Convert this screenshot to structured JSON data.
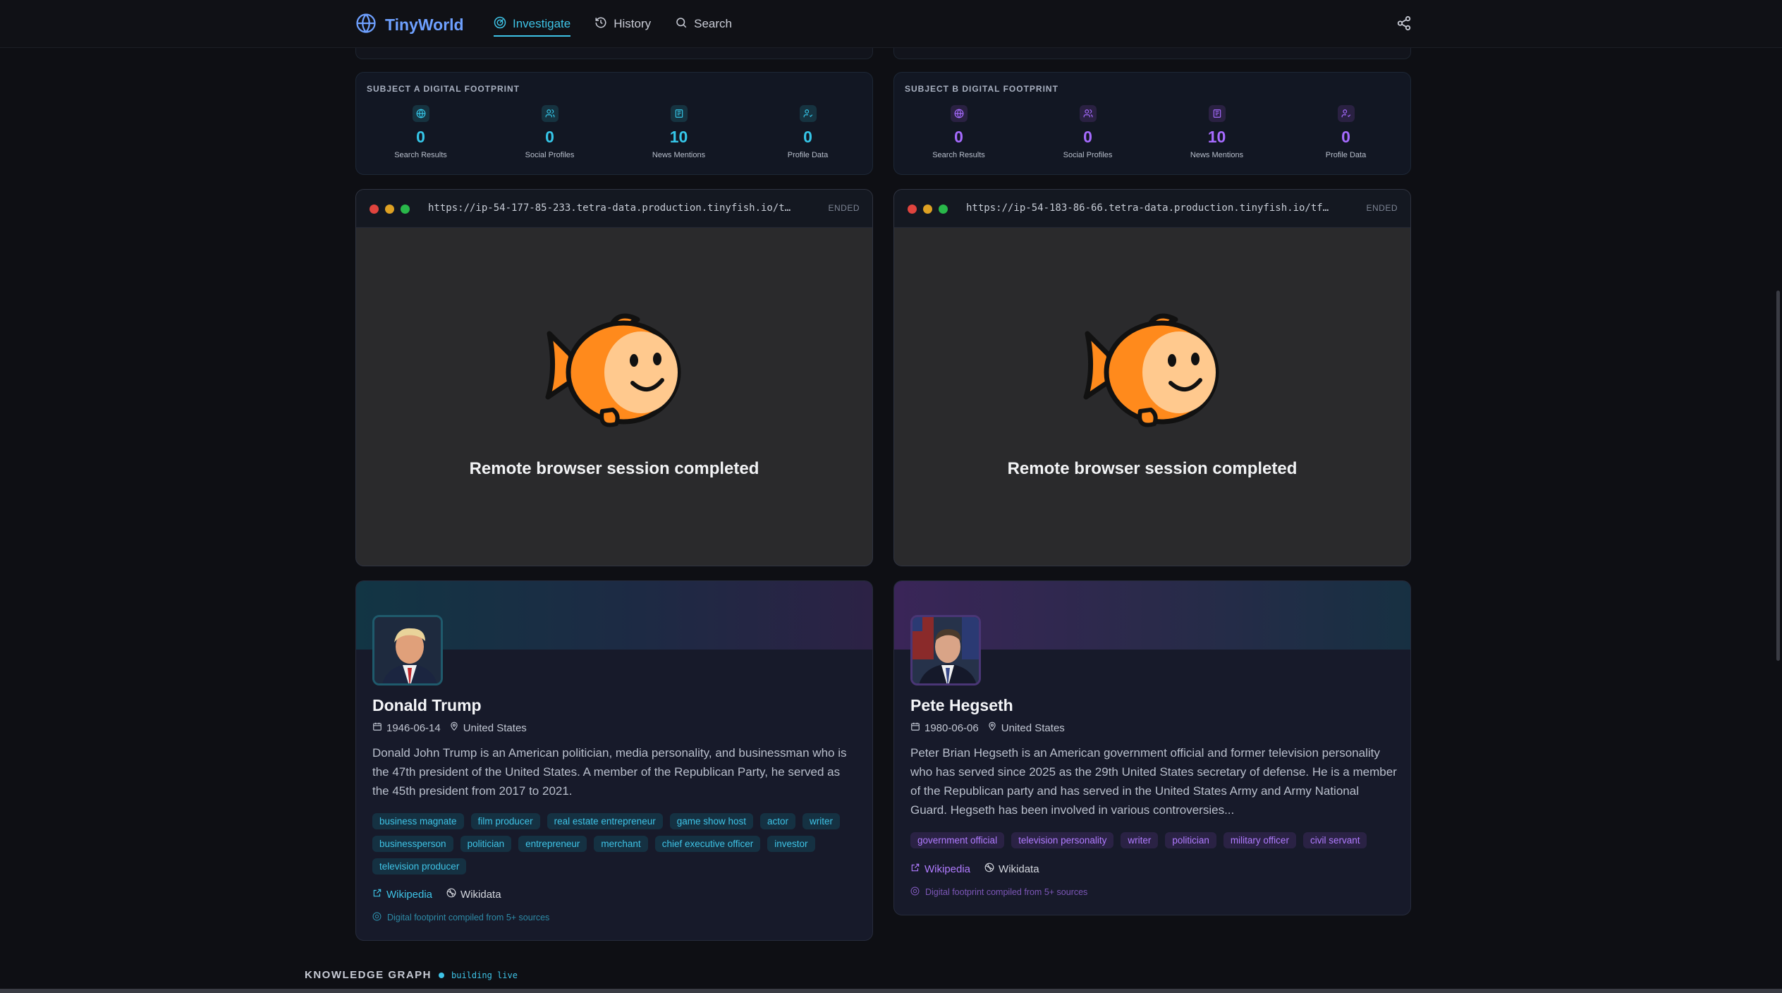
{
  "app": {
    "name": "TinyWorld"
  },
  "nav": {
    "investigate": "Investigate",
    "history": "History",
    "search": "Search"
  },
  "subject_a": {
    "footprint_title": "SUBJECT A DIGITAL FOOTPRINT",
    "stats": [
      {
        "value": "0",
        "label": "Search Results",
        "icon": "globe-icon"
      },
      {
        "value": "0",
        "label": "Social Profiles",
        "icon": "users-icon"
      },
      {
        "value": "10",
        "label": "News Mentions",
        "icon": "newspaper-icon"
      },
      {
        "value": "0",
        "label": "Profile Data",
        "icon": "user-check-icon"
      }
    ],
    "browser": {
      "url": "https://ip-54-177-85-233.tetra-data.production.tinyfish.io/t…",
      "status": "ENDED",
      "message": "Remote browser session completed"
    },
    "profile": {
      "name": "Donald Trump",
      "birth_date": "1946-06-14",
      "country": "United States",
      "bio": "Donald John Trump is an American politician, media personality, and businessman who is the 47th president of the United States. A member of the Republican Party, he served as the 45th president from 2017 to 2021.",
      "tags": [
        "business magnate",
        "film producer",
        "real estate entrepreneur",
        "game show host",
        "actor",
        "writer",
        "businessperson",
        "politician",
        "entrepreneur",
        "merchant",
        "chief executive officer",
        "investor",
        "television producer"
      ],
      "wikipedia": "Wikipedia",
      "wikidata": "Wikidata",
      "footnote": "Digital footprint compiled from 5+ sources"
    },
    "accent": "#35c6e8"
  },
  "subject_b": {
    "footprint_title": "SUBJECT B DIGITAL FOOTPRINT",
    "stats": [
      {
        "value": "0",
        "label": "Search Results",
        "icon": "globe-icon"
      },
      {
        "value": "0",
        "label": "Social Profiles",
        "icon": "users-icon"
      },
      {
        "value": "10",
        "label": "News Mentions",
        "icon": "newspaper-icon"
      },
      {
        "value": "0",
        "label": "Profile Data",
        "icon": "user-check-icon"
      }
    ],
    "browser": {
      "url": "https://ip-54-183-86-66.tetra-data.production.tinyfish.io/tf…",
      "status": "ENDED",
      "message": "Remote browser session completed"
    },
    "profile": {
      "name": "Pete Hegseth",
      "birth_date": "1980-06-06",
      "country": "United States",
      "bio": "Peter Brian Hegseth is an American government official and former television personality who has served since 2025 as the 29th United States secretary of defense. He is a member of the Republican party and has served in the United States Army and Army National Guard. Hegseth has been involved in various controversies...",
      "tags": [
        "government official",
        "television personality",
        "writer",
        "politician",
        "military officer",
        "civil servant"
      ],
      "wikipedia": "Wikipedia",
      "wikidata": "Wikidata",
      "footnote": "Digital footprint compiled from 5+ sources"
    },
    "accent": "#a66bff"
  },
  "knowledge_graph": {
    "title": "KNOWLEDGE GRAPH",
    "status": "building live"
  }
}
